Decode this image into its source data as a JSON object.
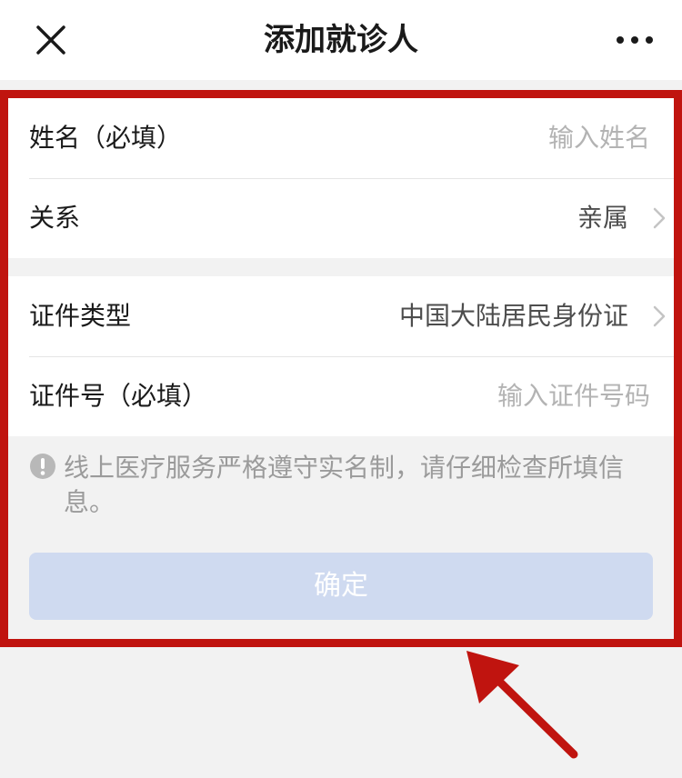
{
  "navbar": {
    "title": "添加就诊人",
    "close_icon": "close-icon",
    "more_icon": "more-dots-icon"
  },
  "form": {
    "name": {
      "label": "姓名（必填）",
      "placeholder": "输入姓名"
    },
    "relation": {
      "label": "关系",
      "value": "亲属",
      "icon": "chevron-right-icon"
    },
    "id_type": {
      "label": "证件类型",
      "value": "中国大陆居民身份证",
      "icon": "chevron-right-icon"
    },
    "id_number": {
      "label": "证件号（必填）",
      "placeholder": "输入证件号码"
    }
  },
  "notice": {
    "icon": "info-exclamation-icon",
    "text": "线上医疗服务严格遵守实名制，请仔细检查所填信息。"
  },
  "confirm_button": {
    "label": "确定",
    "background": "#cfdaf0"
  },
  "annotation": {
    "frame_color": "#c0140f",
    "arrow_icon": "pointer-arrow-icon"
  }
}
